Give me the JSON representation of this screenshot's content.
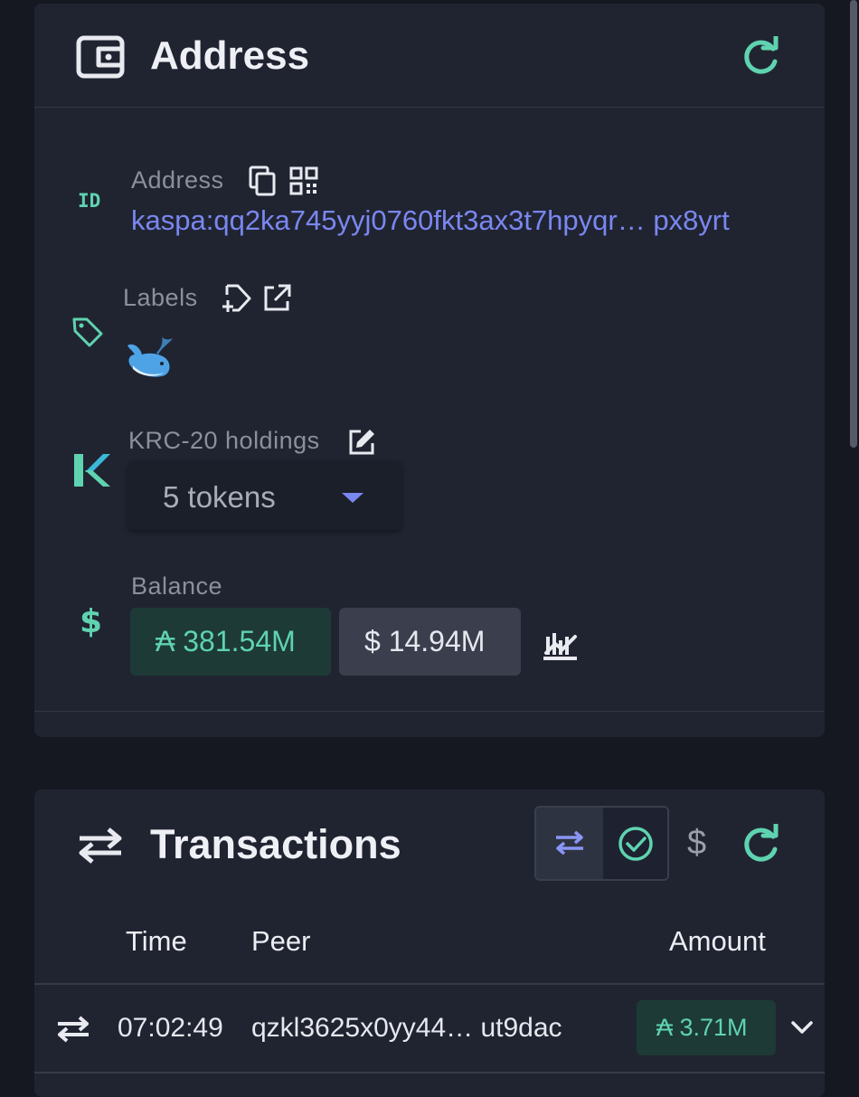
{
  "colors": {
    "background": "#151820",
    "card": "#202431",
    "accent_green": "#5fd3b0",
    "link_blue": "#7a87f0",
    "muted_text": "#8c909c"
  },
  "address_card": {
    "title": "Address",
    "header_icon": "wallet-icon",
    "refresh_icon": "refresh-icon",
    "address": {
      "label": "Address",
      "row_icon": "id-icon",
      "value": "kaspa:qq2ka745yyj0760fkt3ax3t7hpyqr… px8yrt"
    },
    "labels": {
      "label": "Labels",
      "row_icon": "tag-icon",
      "emoji": "🐋"
    },
    "krc20": {
      "label": "KRC-20 holdings",
      "row_icon": "k-logo-icon",
      "selected": "5 tokens"
    },
    "balance": {
      "label": "Balance",
      "row_icon": "dollar-icon",
      "kas": "₳ 381.54M",
      "usd": "$ 14.94M"
    }
  },
  "transactions_card": {
    "title": "Transactions",
    "title_icon": "transfer-arrows-icon",
    "currency_toggle": "$",
    "columns": [
      "Time",
      "Peer",
      "Amount"
    ],
    "rows": [
      {
        "time": "07:02:49",
        "peer": "qzkl3625x0yy44… ut9dac",
        "amount": "₳ 3.71M"
      }
    ]
  }
}
